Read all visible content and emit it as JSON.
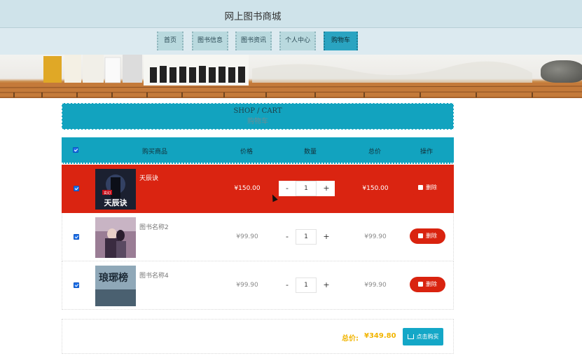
{
  "site": {
    "title": "网上图书商城"
  },
  "nav": {
    "items": [
      {
        "label": "首页"
      },
      {
        "label": "图书信息"
      },
      {
        "label": "图书资讯"
      },
      {
        "label": "个人中心"
      },
      {
        "label": "购物车",
        "active": true
      }
    ]
  },
  "section": {
    "title_en": "SHOP / CART",
    "title_cn": "购物车"
  },
  "table": {
    "headers": [
      "购买商品",
      "价格",
      "数量",
      "总价",
      "操作"
    ],
    "all_checked": true,
    "rows": [
      {
        "name": "天辰诀",
        "price": "¥150.00",
        "qty": "1",
        "total": "¥150.00",
        "checked": true,
        "highlighted": true,
        "minus": "-",
        "plus": "+",
        "delete_label": "删除",
        "cover_text": "天辰诀",
        "cover_badge": "玄幻"
      },
      {
        "name": "图书名称2",
        "price": "¥99.90",
        "qty": "1",
        "total": "¥99.90",
        "checked": true,
        "highlighted": false,
        "minus": "-",
        "plus": "+",
        "delete_label": "删除"
      },
      {
        "name": "图书名称4",
        "price": "¥99.90",
        "qty": "1",
        "total": "¥99.90",
        "checked": true,
        "highlighted": false,
        "minus": "-",
        "plus": "+",
        "delete_label": "删除",
        "cover_text": "琅琊榜"
      }
    ]
  },
  "summary": {
    "total_label": "总价:",
    "total_value": "¥349.80",
    "buy_label": "点击购买"
  },
  "colors": {
    "accent": "#12a3bf",
    "danger": "#da2411",
    "highlight_total": "#f1b400",
    "topbar": "#cfe3ea"
  },
  "icons": {
    "checkbox": "checkbox-checked-icon",
    "delete": "trash-icon",
    "buy": "cart-icon"
  }
}
